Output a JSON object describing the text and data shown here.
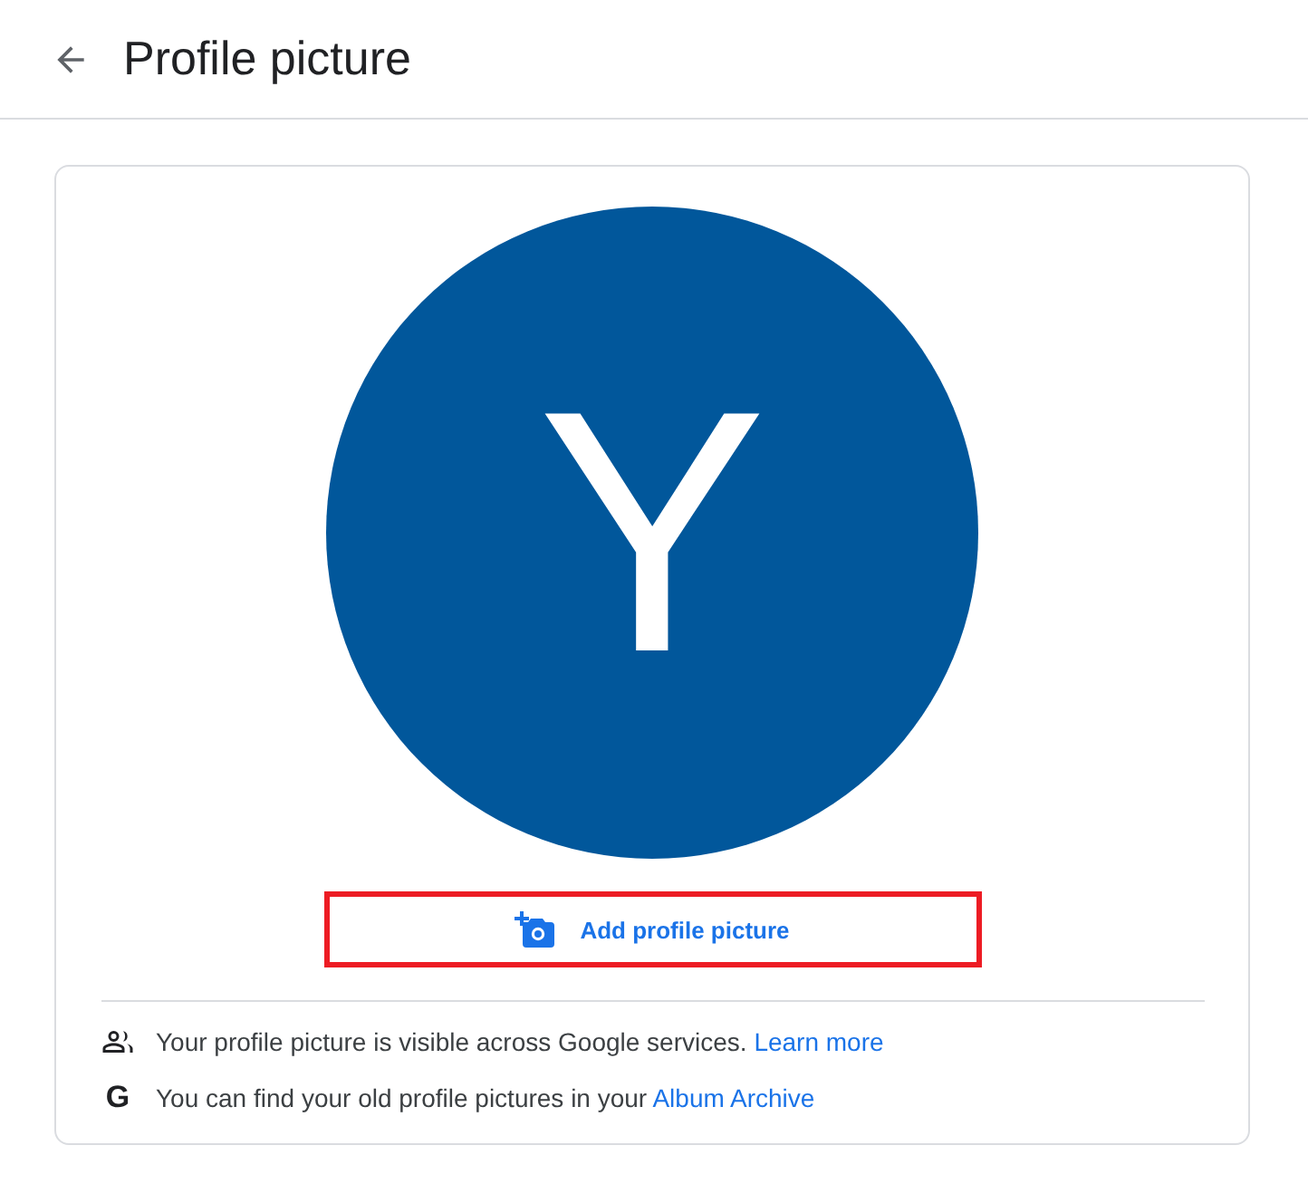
{
  "header": {
    "title": "Profile picture"
  },
  "avatar": {
    "initial": "Y",
    "color": "#01579b"
  },
  "add_button": {
    "label": "Add profile picture",
    "highlighted": true
  },
  "notes": [
    {
      "kind": "people",
      "text": "Your profile picture is visible across Google services.",
      "link": "Learn more"
    },
    {
      "kind": "letter",
      "icon_text": "G",
      "text": "You can find your old profile pictures in your",
      "link": "Album Archive"
    }
  ]
}
